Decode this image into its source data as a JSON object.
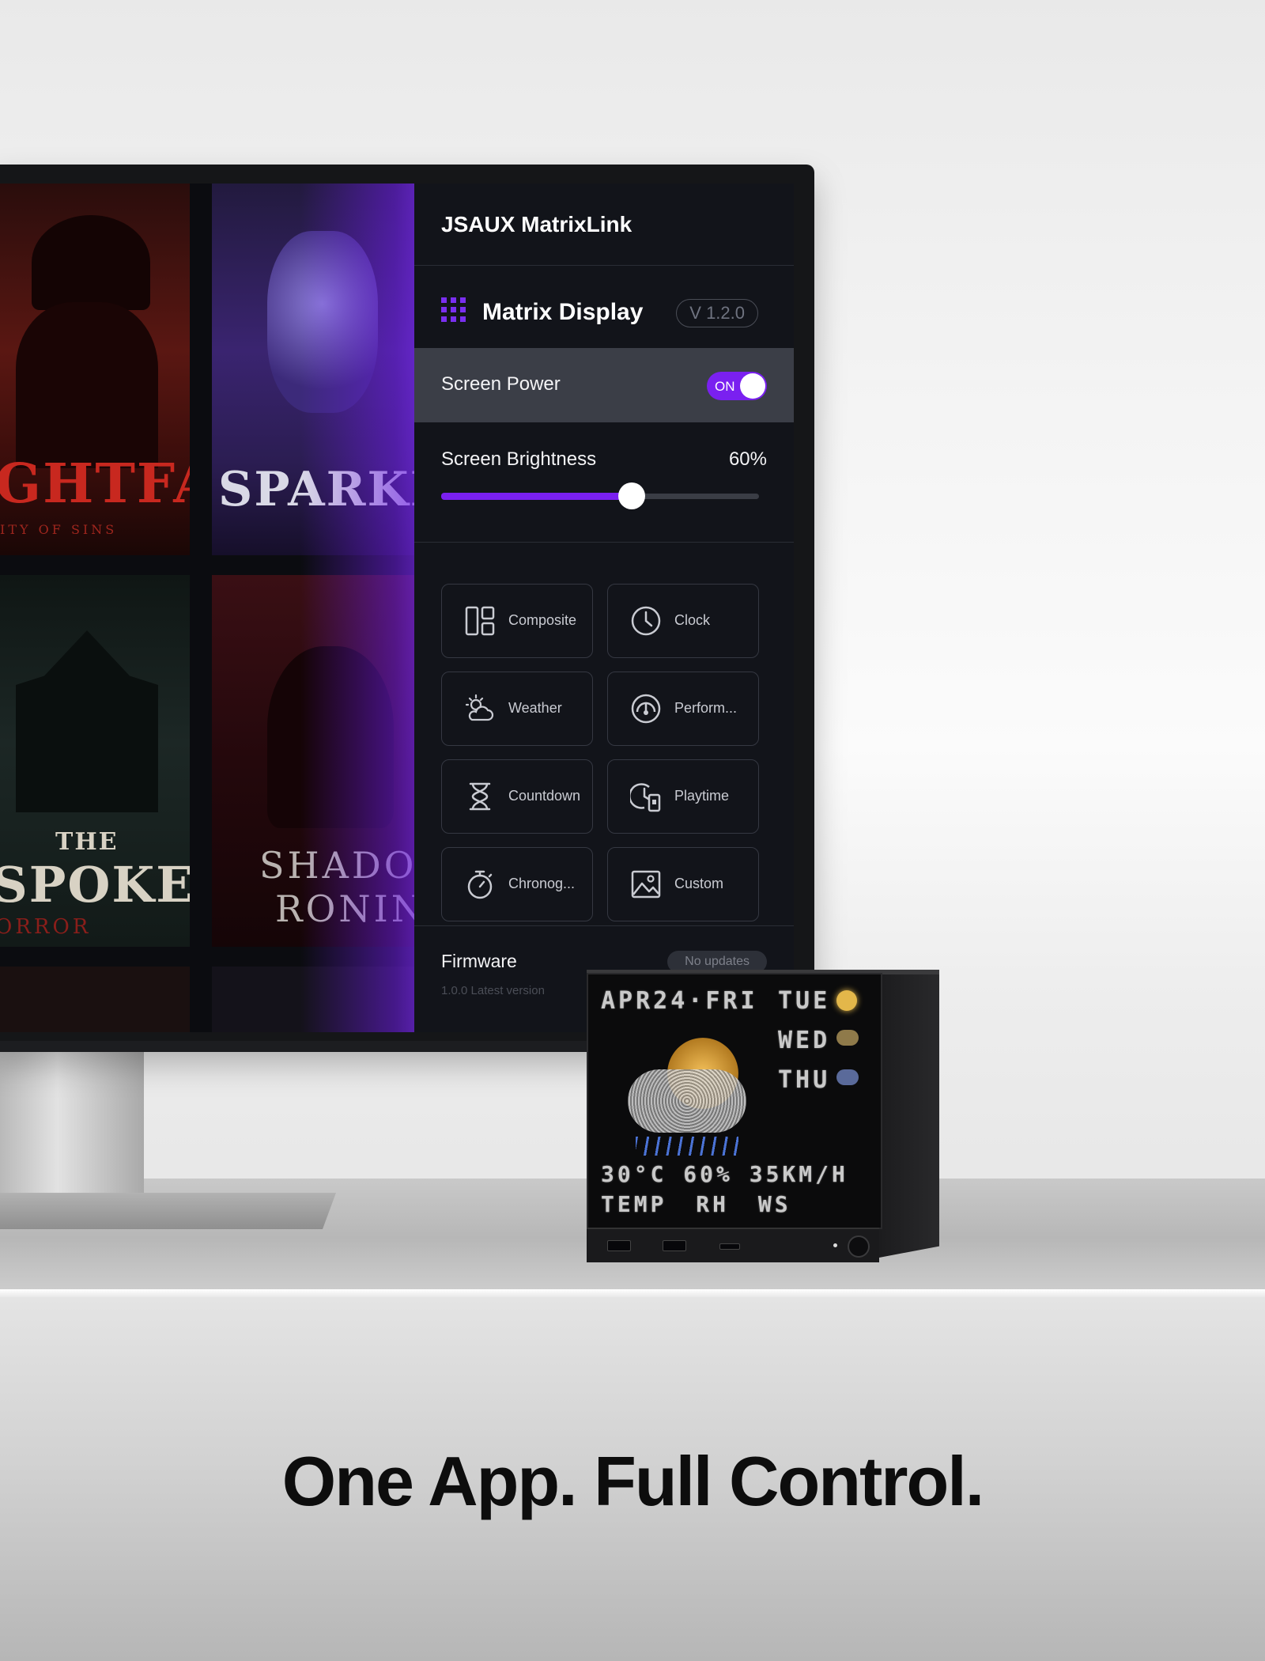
{
  "library": {
    "tiles": [
      {
        "title": "GHTFALL",
        "subtitle": "ITY OF SINS"
      },
      {
        "title": "SPARKBOU",
        "subtitle": ""
      },
      {
        "title": "THE",
        "title2": "SPOKEN",
        "subtitle": "ORROR"
      },
      {
        "title": "SHADO",
        "title2": "RONIN",
        "subtitle": ""
      }
    ]
  },
  "app": {
    "title": "JSAUX MatrixLink",
    "device_name": "Matrix Display",
    "version": "V 1.2.0",
    "screen_power": {
      "label": "Screen Power",
      "state": "ON"
    },
    "brightness": {
      "label": "Screen Brightness",
      "value_text": "60%",
      "value": 0.6
    },
    "widgets": [
      {
        "label": "Composite",
        "icon": "composite-icon"
      },
      {
        "label": "Clock",
        "icon": "clock-icon"
      },
      {
        "label": "Weather",
        "icon": "weather-icon"
      },
      {
        "label": "Perform...",
        "icon": "performance-icon"
      },
      {
        "label": "Countdown",
        "icon": "hourglass-icon"
      },
      {
        "label": "Playtime",
        "icon": "playtime-icon"
      },
      {
        "label": "Chronog...",
        "icon": "stopwatch-icon"
      },
      {
        "label": "Custom",
        "icon": "image-icon"
      }
    ],
    "firmware": {
      "label": "Firmware",
      "sub": "1.0.0 Latest version",
      "badge": "No updates"
    },
    "accent": "#7a20f0"
  },
  "device_display": {
    "date": "APR24·FRI",
    "days": [
      "TUE",
      "WED",
      "THU"
    ],
    "stats": "30°C 60% 35KM/H",
    "stat_labels": "TEMP RH WS"
  },
  "tagline": "One App. Full Control."
}
